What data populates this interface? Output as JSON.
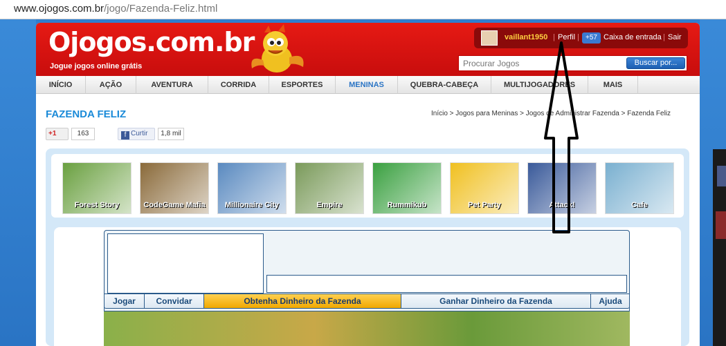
{
  "browser": {
    "url_host": "www.ojogos.com.br",
    "url_path": "/jogo/Fazenda-Feliz.html"
  },
  "header": {
    "logo": "Ojogos.com.br",
    "tagline": "Jogue jogos online grátis",
    "username": "vaillant1950",
    "profile_label": "Perfil",
    "message_count": "+57",
    "inbox_label": "Caixa de entrada",
    "logout_label": "Sair",
    "search_placeholder": "Procurar Jogos",
    "search_button": "Buscar por..."
  },
  "nav": [
    {
      "label": "INÍCIO"
    },
    {
      "label": "AÇÃO"
    },
    {
      "label": "AVENTURA"
    },
    {
      "label": "CORRIDA"
    },
    {
      "label": "ESPORTES"
    },
    {
      "label": "MENINAS"
    },
    {
      "label": "QUEBRA-CABEÇA"
    },
    {
      "label": "MULTIJOGADORES"
    },
    {
      "label": "MAIS"
    }
  ],
  "page": {
    "title": "FAZENDA FELIZ",
    "breadcrumb": "Início > Jogos para Meninas > Jogos de Administrar Fazenda > Fazenda Feliz"
  },
  "social": {
    "gplus_label": "+1",
    "gplus_count": "163",
    "fb_label": "Curtir",
    "fb_count": "1,8 mil"
  },
  "thumbnails": [
    {
      "title": "Forest Story",
      "color": "#6aa040"
    },
    {
      "title": "CodeGame Mafia",
      "color": "#8a6a3a"
    },
    {
      "title": "Millionaire City",
      "color": "#5a8ac0"
    },
    {
      "title": "Empire",
      "color": "#7a9a5a"
    },
    {
      "title": "Rummikub",
      "color": "#3aa040"
    },
    {
      "title": "Pet Party",
      "color": "#f0c020"
    },
    {
      "title": "Attack!",
      "color": "#3a5a9a"
    },
    {
      "title": "Cafe",
      "color": "#7ab0d0"
    }
  ],
  "game_tabs": [
    {
      "label": "Jogar"
    },
    {
      "label": "Convidar"
    },
    {
      "label": "Obtenha Dinheiro da Fazenda"
    },
    {
      "label": "Ganhar Dinheiro da Fazenda"
    },
    {
      "label": "Ajuda"
    }
  ],
  "colors": {
    "brand_red": "#d81010",
    "accent_blue": "#2a74c4",
    "highlight_tab": "#f0a800"
  }
}
